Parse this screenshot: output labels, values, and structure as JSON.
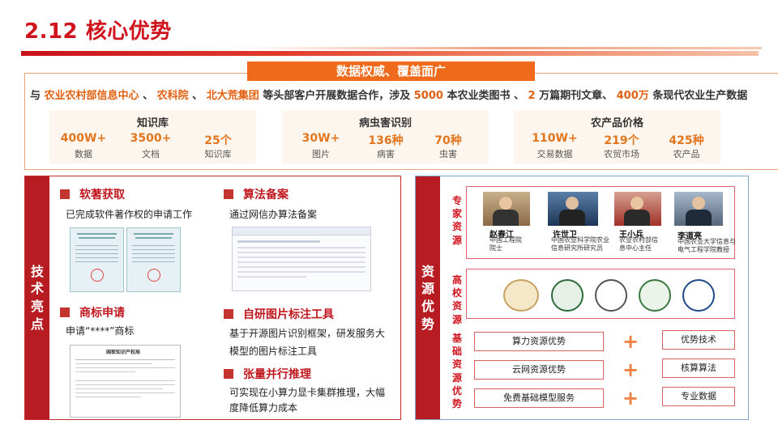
{
  "title": "2.12 核心优势",
  "banner": "数据权威、覆盖面广",
  "intro": {
    "p1": "与 ",
    "org1": "农业农村部信息中心",
    "sep1": " 、 ",
    "org2": "农科院",
    "sep2": " 、 ",
    "org3": "北大荒集团",
    "p2": " 等头部客户开展数据合作，涉及 ",
    "n1": "5000",
    "p3": " 本农业类图书 、 ",
    "n2": "2",
    "p4": " 万篇期刊文章、 ",
    "n3": "400万",
    "p5": " 条现代农业生产数据"
  },
  "panels": [
    {
      "title": "知识库",
      "stats": [
        {
          "num": "400W+",
          "label": "数据"
        },
        {
          "num": "3500+",
          "label": "文档"
        },
        {
          "num": "25个",
          "label": "知识库"
        }
      ]
    },
    {
      "title": "病虫害识别",
      "stats": [
        {
          "num": "30W+",
          "label": "图片"
        },
        {
          "num": "136种",
          "label": "病害"
        },
        {
          "num": "70种",
          "label": "虫害"
        }
      ]
    },
    {
      "title": "农产品价格",
      "stats": [
        {
          "num": "110W+",
          "label": "交易数据"
        },
        {
          "num": "219个",
          "label": "农贸市场"
        },
        {
          "num": "425种",
          "label": "农产品"
        }
      ]
    }
  ],
  "tech": {
    "tab": "技术亮点",
    "s1": {
      "h": "软著获取",
      "t": "已完成软件著作权的申请工作"
    },
    "s2": {
      "h": "算法备案",
      "t": "通过网信办算法备案"
    },
    "s3": {
      "h": "商标申请",
      "t": "申请“****”商标"
    },
    "s4": {
      "h": "自研图片标注工具",
      "t1": "基于开源图片识别框架，研发服务大",
      "t2": "模型的图片标注工具"
    },
    "s5": {
      "h": "张量并行推理",
      "t1": "可实现在小算力显卡集群推理，大幅",
      "t2": "度降低算力成本"
    },
    "doc_header": "国家知识产权局"
  },
  "resource": {
    "tab": "资源优势",
    "expert_label": "专家资源",
    "univ_label": "高校资源",
    "base_label": "基础资源优势",
    "experts": [
      {
        "name": "赵春江",
        "t1": "中国工程院",
        "t2": "院士"
      },
      {
        "name": "许世卫",
        "t1": "中国农业科学院农业",
        "t2": "信息研究所研究员"
      },
      {
        "name": "王小兵",
        "t1": "农业农村部信",
        "t2": "息中心主任"
      },
      {
        "name": "李道亮",
        "t1": "中国农业大学信息与",
        "t2": "电气工程学院教授"
      }
    ],
    "base_left": [
      "算力资源优势",
      "云网资源优势",
      "免费基础模型服务"
    ],
    "base_right": [
      "优势技术",
      "核算算法",
      "专业数据"
    ],
    "plus": "+"
  },
  "colors": {
    "brand_red": "#d0141e",
    "accent_orange": "#ef6a1a",
    "tab_red": "#b71c22"
  }
}
